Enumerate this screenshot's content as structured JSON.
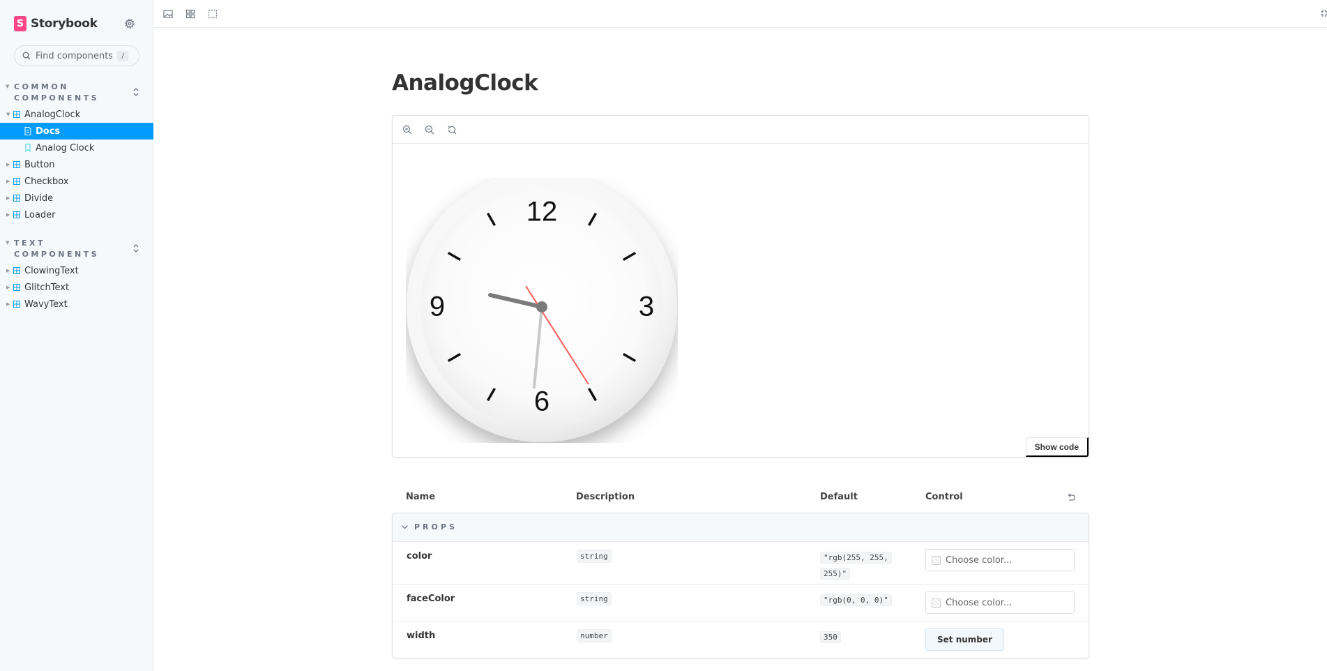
{
  "sidebar": {
    "brand_name": "Storybook",
    "brand_logo_letter": "S",
    "search": {
      "placeholder": "Find components",
      "shortcut": "/"
    },
    "groups": [
      {
        "title": "COMMON COMPONENTS",
        "items": [
          {
            "label": "AnalogClock",
            "expanded": true,
            "children": [
              {
                "label": "Docs",
                "selected": true
              },
              {
                "label": "Analog Clock",
                "selected": false
              }
            ]
          },
          {
            "label": "Button"
          },
          {
            "label": "Checkbox"
          },
          {
            "label": "Divide"
          },
          {
            "label": "Loader"
          }
        ]
      },
      {
        "title": "TEXT COMPONENTS",
        "items": [
          {
            "label": "ClowingText"
          },
          {
            "label": "GlitchText"
          },
          {
            "label": "WavyText"
          }
        ]
      }
    ],
    "colors": {
      "selected_bg": "#029cfd",
      "logo": "#ff4785"
    }
  },
  "toolbar": {
    "icons": [
      "image-icon",
      "grid-icon",
      "outline-icon",
      "fullscreen-icon"
    ]
  },
  "docs": {
    "title": "AnalogClock",
    "canvas": {
      "zoom_icons": [
        "zoom-in-icon",
        "zoom-out-icon",
        "zoom-reset-icon"
      ],
      "show_code_label": "Show code",
      "clock": {
        "numerals": [
          "12",
          "3",
          "6",
          "9"
        ],
        "hour_hand_color": "#7a7a7a",
        "minute_hand_color": "#c8c8c8",
        "second_hand_color": "#ff5a5a"
      }
    },
    "args_table": {
      "headers": {
        "name": "Name",
        "description": "Description",
        "default": "Default",
        "control": "Control"
      },
      "section": "PROPS",
      "rows": [
        {
          "name": "color",
          "type": "string",
          "default": "\"rgb(255, 255, 255)\"",
          "control": "color",
          "placeholder": "Choose color..."
        },
        {
          "name": "faceColor",
          "type": "string",
          "default": "\"rgb(0, 0, 0)\"",
          "control": "color",
          "placeholder": "Choose color..."
        },
        {
          "name": "width",
          "type": "number",
          "default": "350",
          "control": "number",
          "button_label": "Set number"
        }
      ]
    }
  }
}
